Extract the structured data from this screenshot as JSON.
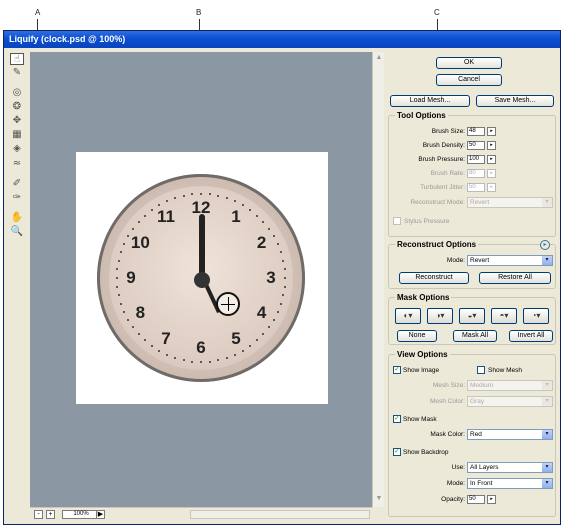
{
  "callouts": {
    "a": "A",
    "b": "B",
    "c": "C"
  },
  "window": {
    "title": "Liquify (clock.psd @ 100%)"
  },
  "tools": [
    {
      "name": "forward-warp-tool-icon",
      "glyph": "☝"
    },
    {
      "name": "reconstruct-tool-icon",
      "glyph": "✎"
    },
    {
      "name": "twirl-tool-icon",
      "glyph": "◎"
    },
    {
      "name": "pucker-tool-icon",
      "glyph": "❂"
    },
    {
      "name": "bloat-tool-icon",
      "glyph": "✥"
    },
    {
      "name": "push-left-tool-icon",
      "glyph": "▦"
    },
    {
      "name": "mirror-tool-icon",
      "glyph": "◈"
    },
    {
      "name": "turbulence-tool-icon",
      "glyph": "≈"
    },
    {
      "name": "freeze-mask-tool-icon",
      "glyph": "✐"
    },
    {
      "name": "thaw-mask-tool-icon",
      "glyph": "✑"
    },
    {
      "name": "hand-tool-icon",
      "glyph": "✋"
    },
    {
      "name": "zoom-tool-icon",
      "glyph": "🔍"
    }
  ],
  "status": {
    "zoom_out": "-",
    "zoom_in": "+",
    "zoom": "100%",
    "arrow": "▶"
  },
  "clock": {
    "numbers": [
      "12",
      "1",
      "2",
      "3",
      "4",
      "5",
      "6",
      "7",
      "8",
      "9",
      "10",
      "11"
    ]
  },
  "buttons": {
    "ok": "OK",
    "cancel": "Cancel",
    "load_mesh": "Load Mesh...",
    "save_mesh": "Save Mesh..."
  },
  "tool_options": {
    "title": "Tool Options",
    "brush_size_label": "Brush Size:",
    "brush_size": "48",
    "brush_density_label": "Brush Density:",
    "brush_density": "50",
    "brush_pressure_label": "Brush Pressure:",
    "brush_pressure": "100",
    "brush_rate_label": "Brush Rate:",
    "brush_rate": "80",
    "turbulent_jitter_label": "Turbulent Jitter:",
    "turbulent_jitter": "50",
    "reconstruct_mode_label": "Reconstruct Mode:",
    "reconstruct_mode": "Revert",
    "stylus_pressure": "Stylus Pressure"
  },
  "reconstruct_options": {
    "title": "Reconstruct Options",
    "mode_label": "Mode:",
    "mode": "Revert",
    "reconstruct": "Reconstruct",
    "restore_all": "Restore All"
  },
  "mask_options": {
    "title": "Mask Options",
    "none": "None",
    "mask_all": "Mask All",
    "invert_all": "Invert All"
  },
  "view_options": {
    "title": "View Options",
    "show_image": "Show Image",
    "show_mesh": "Show Mesh",
    "mesh_size_label": "Mesh Size:",
    "mesh_size": "Medium",
    "mesh_color_label": "Mesh Color:",
    "mesh_color": "Gray",
    "show_mask": "Show Mask",
    "mask_color_label": "Mask Color:",
    "mask_color": "Red",
    "show_backdrop": "Show Backdrop",
    "use_label": "Use:",
    "use": "All Layers",
    "mode_label": "Mode:",
    "mode": "In Front",
    "opacity_label": "Opacity:",
    "opacity": "50"
  },
  "icons": {
    "check": "✓",
    "spin": "▸",
    "dropdown": "▾",
    "options": "▸"
  }
}
